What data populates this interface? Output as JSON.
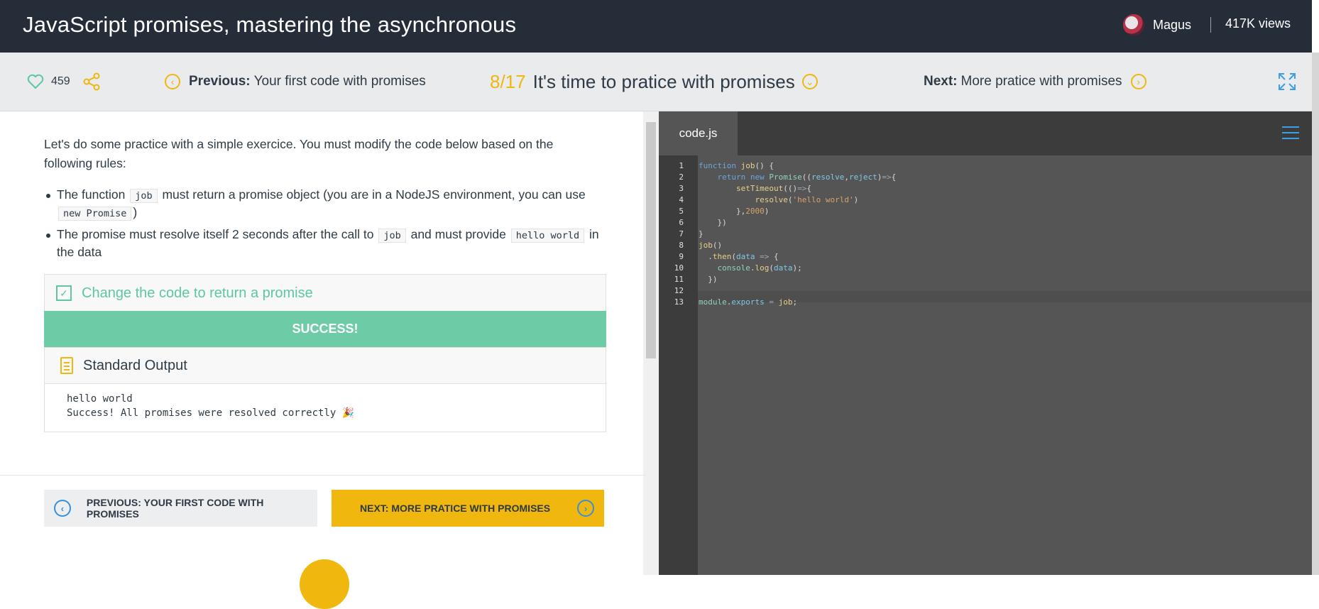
{
  "header": {
    "title": "JavaScript promises, mastering the asynchronous",
    "author": "Magus",
    "views": "417K views"
  },
  "nav": {
    "likes": "459",
    "prev_bold": "Previous:",
    "prev_text": "Your first code with promises",
    "step": "8/17",
    "step_title": "It's time to pratice with promises",
    "next_bold": "Next:",
    "next_text": "More pratice with promises"
  },
  "content": {
    "intro": "Let's do some practice with a simple exercice. You must modify the code below based on the following rules:",
    "rule1": {
      "a": "The function",
      "code1": "job",
      "b": "must return a promise object (you are in a NodeJS environment, you can use",
      "code2": "new Promise",
      "c": ")"
    },
    "rule2": {
      "a": "The promise must resolve itself 2 seconds after the call to",
      "code1": "job",
      "b": "and must provide",
      "code2": "hello world",
      "c": "in the data"
    },
    "task_label": "Change the code to return a promise",
    "success": "SUCCESS!",
    "stdout_title": "Standard Output",
    "stdout_lines": [
      "hello world",
      "Success! All promises were resolved correctly 🎉"
    ],
    "btn_prev": "PREVIOUS: YOUR FIRST CODE WITH PROMISES",
    "btn_next": "NEXT: MORE PRATICE WITH PROMISES"
  },
  "editor": {
    "filename": "code.js",
    "line_numbers": [
      "1",
      "2",
      "3",
      "4",
      "5",
      "6",
      "7",
      "8",
      "9",
      "10",
      "11",
      "12",
      "13"
    ]
  },
  "colors": {
    "accent": "#f0b70f",
    "success": "#6dcba6",
    "header_bg": "#252e38",
    "editor_bg": "#555555"
  },
  "icons": [
    "heart-icon",
    "share-icon",
    "chevron-left-icon",
    "chevron-down-icon",
    "chevron-right-icon",
    "expand-icon",
    "checkbox-icon",
    "clipboard-icon",
    "menu-icon"
  ]
}
